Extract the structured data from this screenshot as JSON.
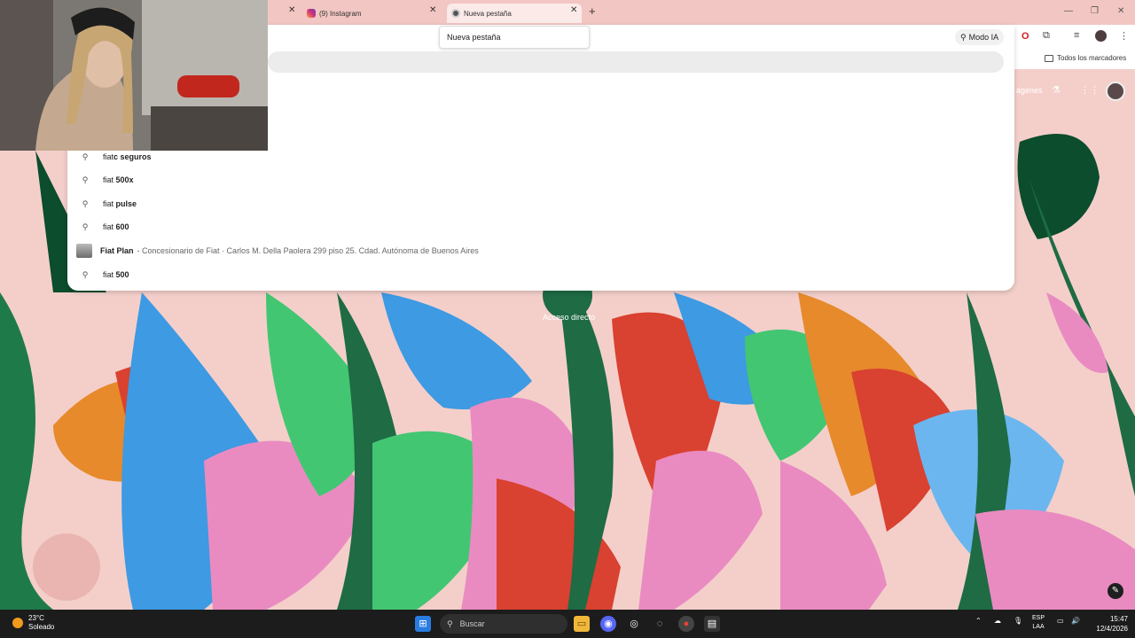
{
  "tabs": [
    {
      "title": "(9) Instagram",
      "icon": "instagram-icon",
      "active": false
    },
    {
      "title": "Nueva pestaña",
      "icon": "chrome-icon",
      "active": true
    }
  ],
  "tooltip": "Nueva pestaña",
  "toolbar": {
    "mode_ia_label": "Modo IA",
    "bookmarks_folder_label": "Todos los marcadores"
  },
  "suggestions": [
    {
      "icon": "search-icon",
      "prefix": "fiat",
      "bold": "c seguros",
      "detail": ""
    },
    {
      "icon": "search-icon",
      "prefix": "fiat",
      "bold": " 500x",
      "detail": ""
    },
    {
      "icon": "search-icon",
      "prefix": "fiat",
      "bold": " pulse",
      "detail": ""
    },
    {
      "icon": "search-icon",
      "prefix": "fiat",
      "bold": " 600",
      "detail": ""
    },
    {
      "icon": "place-thumbnail",
      "prefix": "",
      "bold": "Fiat Plan",
      "detail": "- Concesionario de Fiat · Carlos M. Della Paolera 299 piso 25. Cdad. Autónoma de Buenos Aires"
    },
    {
      "icon": "search-icon",
      "prefix": "fiat",
      "bold": " 500",
      "detail": ""
    }
  ],
  "ntp": {
    "images_partial_label": "ágenes",
    "shortcut_label": "Acceso directo"
  },
  "taskbar": {
    "weather_temp": "23°C",
    "weather_desc": "Soleado",
    "search_placeholder": "Buscar",
    "lang_top": "ESP",
    "lang_bottom": "LAA",
    "time": "15:47",
    "date": "12/4/2026"
  },
  "colors": {
    "wallpaper_bg": "#f4cfca",
    "tabstrip": "#f2c6c2",
    "taskbar": "#1c1c1c"
  }
}
